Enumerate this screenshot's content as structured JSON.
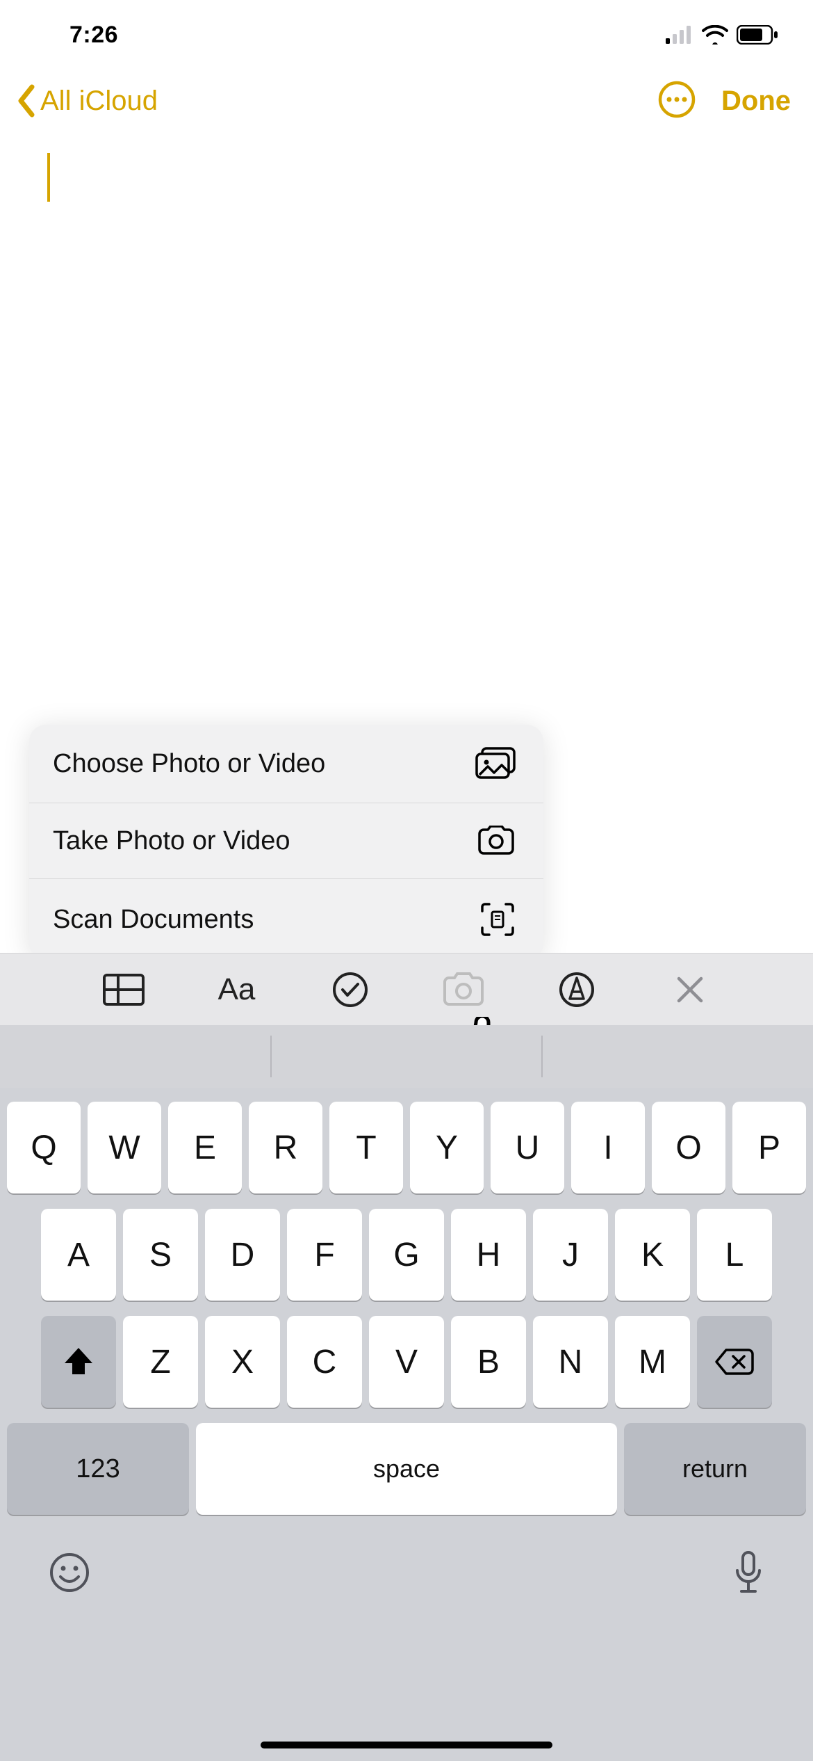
{
  "status": {
    "time": "7:26"
  },
  "nav": {
    "back_label": "All iCloud",
    "done_label": "Done"
  },
  "popover": {
    "items": [
      {
        "label": "Choose Photo or Video",
        "icon": "photos-icon"
      },
      {
        "label": "Take Photo or Video",
        "icon": "camera-icon"
      },
      {
        "label": "Scan Documents",
        "icon": "scan-doc-icon"
      }
    ]
  },
  "toolbar": {
    "text_style_label": "Aa"
  },
  "keyboard": {
    "row1": [
      "Q",
      "W",
      "E",
      "R",
      "T",
      "Y",
      "U",
      "I",
      "O",
      "P"
    ],
    "row2": [
      "A",
      "S",
      "D",
      "F",
      "G",
      "H",
      "J",
      "K",
      "L"
    ],
    "row3": [
      "Z",
      "X",
      "C",
      "V",
      "B",
      "N",
      "M"
    ],
    "numbers_label": "123",
    "space_label": "space",
    "return_label": "return"
  }
}
